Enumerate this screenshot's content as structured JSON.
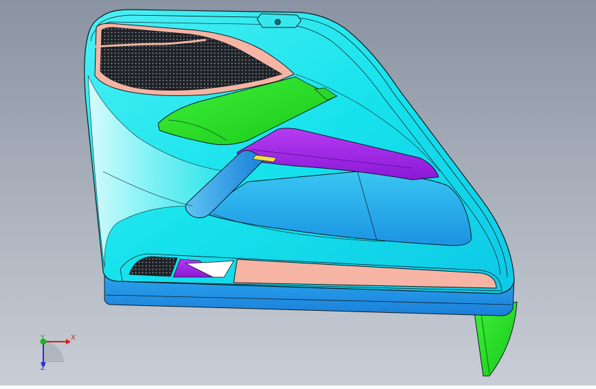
{
  "viewport": {
    "background_top": "#8a93a2",
    "background_bottom": "#c9ced6"
  },
  "colors": {
    "panel_cyan": "#19e6ee",
    "panel_light": "#7ff5f7",
    "panel_blue": "#24b8ee",
    "speaker_green": "#22dd22",
    "armrest_purple": "#aa22ee",
    "handle_blue": "#1a8ee0",
    "insert_pink": "#f5b4a4",
    "grille_dark": "#1f2226",
    "edge_line": "#0d1a22",
    "handle_accent": "#f0e040"
  },
  "triad": {
    "x_label": "X",
    "y_label": "Y",
    "z_label": "Z",
    "x_color": "#e01b1b",
    "y_color": "#20b020",
    "z_color": "#1b2fd8"
  }
}
